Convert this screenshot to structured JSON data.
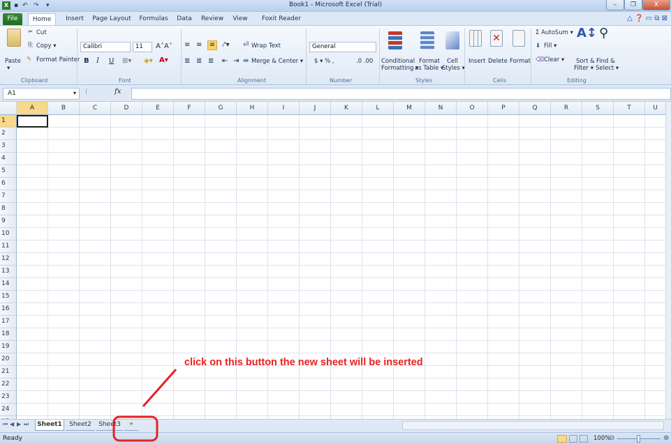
{
  "window": {
    "title": "Book1 - Microsoft Excel (Trial)",
    "controls": {
      "minimize": "–",
      "restore": "❐",
      "close": "X"
    }
  },
  "ribbon_tabs": [
    "File",
    "Home",
    "Insert",
    "Page Layout",
    "Formulas",
    "Data",
    "Review",
    "View",
    "Foxit Reader PDF"
  ],
  "clipboard": {
    "paste": "Paste",
    "cut": "Cut",
    "copy": "Copy ▾",
    "format_painter": "Format Painter",
    "label": "Clipboard"
  },
  "font": {
    "name": "Calibri",
    "size": "11",
    "bold": "B",
    "italic": "I",
    "underline": "U",
    "label": "Font"
  },
  "alignment": {
    "wrap_text": "Wrap Text",
    "merge_center": "Merge & Center ▾",
    "label": "Alignment"
  },
  "number": {
    "format": "General",
    "currency": "$ ▾ %  ,",
    "decimals": ".0 .00",
    "label": "Number"
  },
  "styles": {
    "conditional": "Conditional",
    "conditional2": "Formatting ▾",
    "format_table": "Format",
    "format_table2": "as Table ▾",
    "cell_styles": "Cell",
    "cell_styles2": "Styles ▾",
    "label": "Styles"
  },
  "cells": {
    "insert": "Insert",
    "delete": "Delete",
    "format": "Format",
    "label": "Cells"
  },
  "editing": {
    "autosum": "Σ AutoSum ▾",
    "fill": "Fill ▾",
    "clear": "Clear ▾",
    "sort": "Sort &",
    "sort2": "Filter ▾",
    "find": "Find &",
    "find2": "Select ▾",
    "label": "Editing"
  },
  "formula_bar": {
    "name_box": "A1",
    "fx": "fx"
  },
  "columns": [
    "A",
    "B",
    "C",
    "D",
    "E",
    "F",
    "G",
    "H",
    "I",
    "J",
    "K",
    "L",
    "M",
    "N",
    "O",
    "P",
    "Q",
    "R",
    "S",
    "T",
    "U"
  ],
  "rows": [
    "1",
    "2",
    "3",
    "4",
    "5",
    "6",
    "7",
    "8",
    "9",
    "10",
    "11",
    "12",
    "13",
    "14",
    "15",
    "16",
    "17",
    "18",
    "19",
    "20",
    "21",
    "22",
    "23",
    "24",
    "25"
  ],
  "sheets": [
    "Sheet1",
    "Sheet2",
    "Sheet3"
  ],
  "status": {
    "ready": "Ready",
    "zoom": "100%"
  },
  "annotation": {
    "text": "click on this button the new sheet will be inserted",
    "color": "#e82020"
  }
}
